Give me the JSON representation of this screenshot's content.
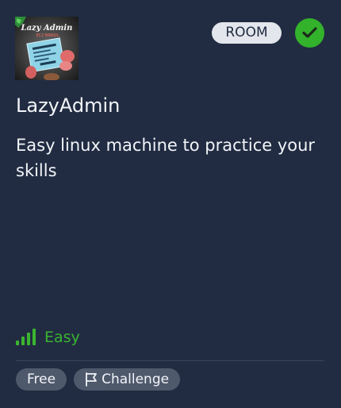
{
  "card": {
    "type_badge": "ROOM",
    "completed_icon": "check-icon",
    "thumbnail_alt": "Lazy Admin",
    "title": "LazyAdmin",
    "description": "Easy linux machine to practice your skills",
    "difficulty": {
      "label": "Easy",
      "icon": "signal-bars-icon",
      "level_of_4": 4,
      "color": "#3bb52f"
    },
    "tags": [
      {
        "label": "Free",
        "icon": ""
      },
      {
        "label": "Challenge",
        "icon": "flag-icon"
      }
    ]
  },
  "colors": {
    "background": "#212c42",
    "success": "#33b22b",
    "badge_bg": "#e3e6ec",
    "tag_bg": "#4f596c"
  }
}
